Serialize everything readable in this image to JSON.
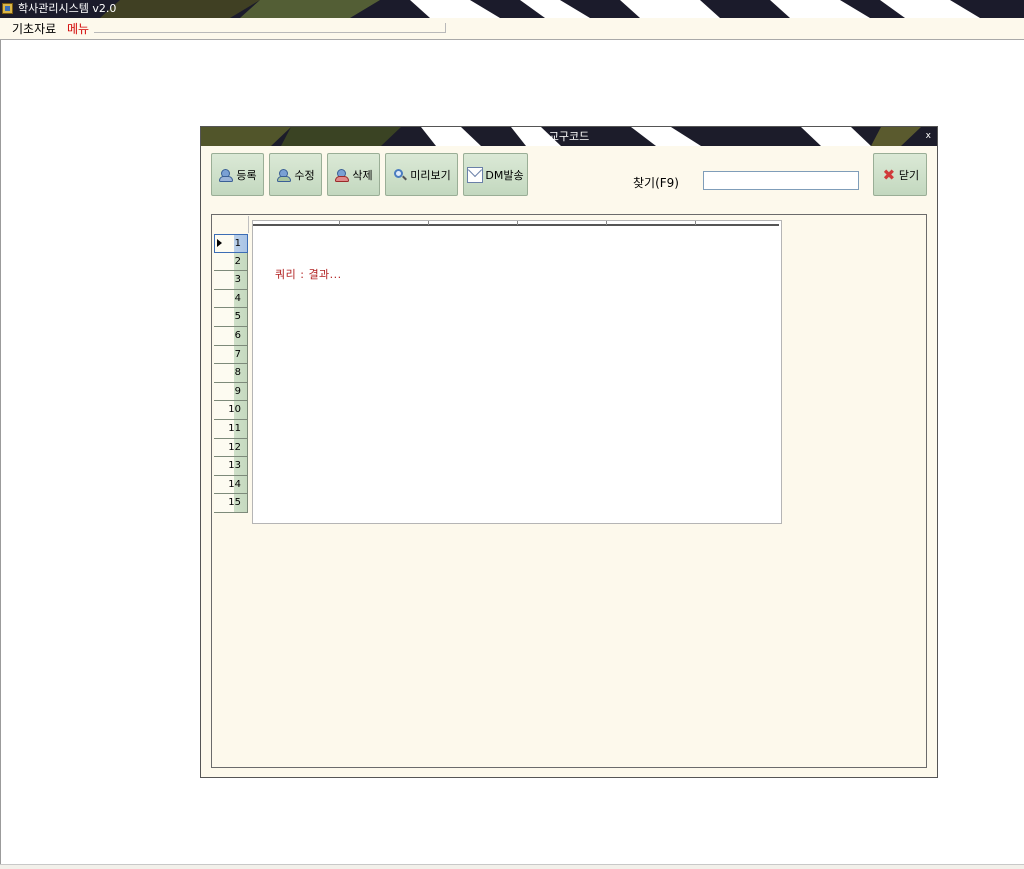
{
  "app": {
    "title": "학사관리시스템 v2.0"
  },
  "menubar": {
    "items": [
      {
        "label": "기초자료"
      },
      {
        "label": "메뉴"
      }
    ]
  },
  "child_window": {
    "title": "교구코드",
    "close_label": "x",
    "toolbar": {
      "register_label": "등록",
      "edit_label": "수정",
      "delete_label": "삭제",
      "preview_label": "미리보기",
      "dm_label": "DM발송",
      "close_label": "닫기"
    },
    "search": {
      "label": "찾기(F9)",
      "value": ""
    },
    "grid": {
      "row_numbers": [
        "1",
        "2",
        "3",
        "4",
        "5",
        "6",
        "7",
        "8",
        "9",
        "10",
        "11",
        "12",
        "13",
        "14",
        "15"
      ],
      "selected_row": "1",
      "query_text": "쿼리 : 결과..."
    }
  },
  "colors": {
    "title_bg": "#1a1a2e",
    "menu_highlight": "#d10000",
    "window_bg": "#fdf9ec",
    "button_bg": "#c3d8bf",
    "query_text": "#b22222"
  }
}
